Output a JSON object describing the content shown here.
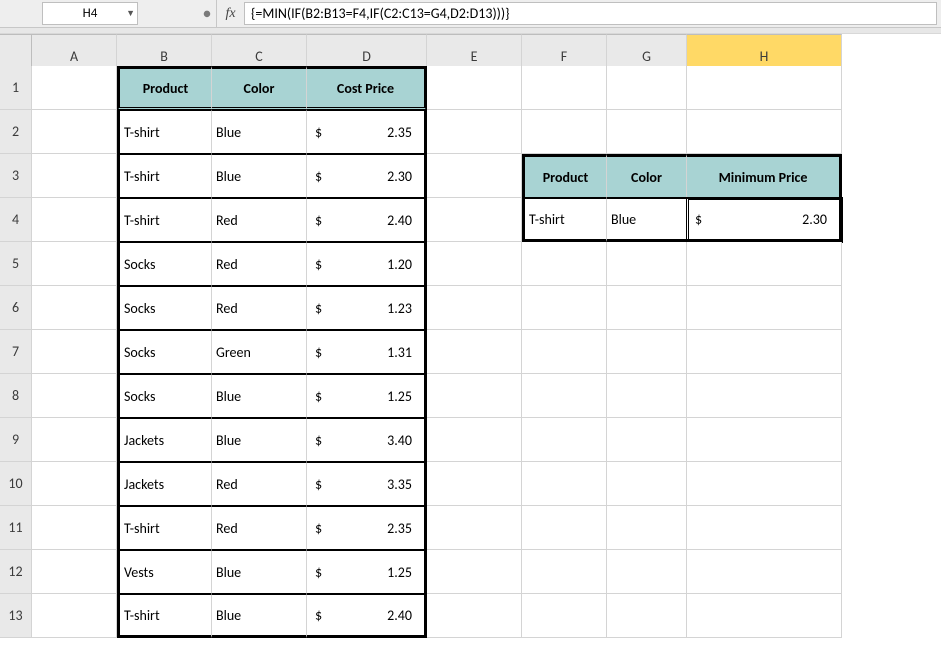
{
  "nameBox": "H4",
  "fxLabel": "fx",
  "formula": "{=MIN(IF(B2:B13=F4,IF(C2:C13=G4,D2:D13)))}",
  "columns": [
    "A",
    "B",
    "C",
    "D",
    "E",
    "F",
    "G",
    "H"
  ],
  "rowCount": 13,
  "selectedCol": "H",
  "selectedRow": 4,
  "table1": {
    "headers": {
      "b": "Product",
      "c": "Color",
      "d": "Cost Price"
    },
    "rows": [
      {
        "b": "T-shirt",
        "c": "Blue",
        "sym": "$",
        "d": "2.35"
      },
      {
        "b": "T-shirt",
        "c": "Blue",
        "sym": "$",
        "d": "2.30"
      },
      {
        "b": "T-shirt",
        "c": "Red",
        "sym": "$",
        "d": "2.40"
      },
      {
        "b": "Socks",
        "c": "Red",
        "sym": "$",
        "d": "1.20"
      },
      {
        "b": "Socks",
        "c": "Red",
        "sym": "$",
        "d": "1.23"
      },
      {
        "b": "Socks",
        "c": "Green",
        "sym": "$",
        "d": "1.31"
      },
      {
        "b": "Socks",
        "c": "Blue",
        "sym": "$",
        "d": "1.25"
      },
      {
        "b": "Jackets",
        "c": "Blue",
        "sym": "$",
        "d": "3.40"
      },
      {
        "b": "Jackets",
        "c": "Red",
        "sym": "$",
        "d": "3.35"
      },
      {
        "b": "T-shirt",
        "c": "Red",
        "sym": "$",
        "d": "2.35"
      },
      {
        "b": "Vests",
        "c": "Blue",
        "sym": "$",
        "d": "1.25"
      },
      {
        "b": "T-shirt",
        "c": "Blue",
        "sym": "$",
        "d": "2.40"
      }
    ]
  },
  "table2": {
    "headers": {
      "f": "Product",
      "g": "Color",
      "h": "Minimum Price"
    },
    "row": {
      "f": "T-shirt",
      "g": "Blue",
      "sym": "$",
      "h": "2.30"
    }
  }
}
